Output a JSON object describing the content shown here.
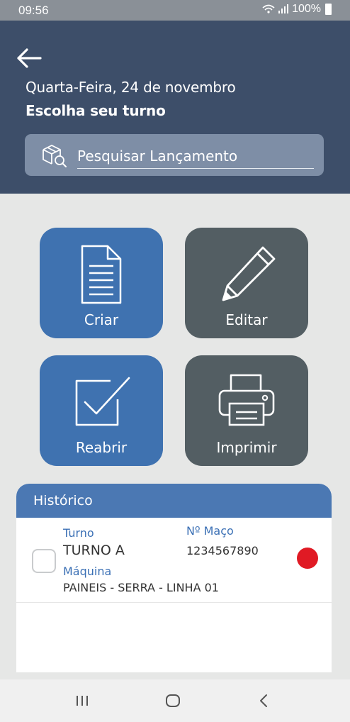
{
  "status_bar": {
    "time": "09:56",
    "battery": "100%"
  },
  "header": {
    "date": "Quarta-Feira, 24 de novembro",
    "subtitle": "Escolha seu turno"
  },
  "search": {
    "placeholder": "Pesquisar Lançamento"
  },
  "actions": [
    {
      "label": "Criar",
      "icon": "document-icon",
      "color": "#3f72b0"
    },
    {
      "label": "Editar",
      "icon": "pencil-icon",
      "color": "#535e63"
    },
    {
      "label": "Reabrir",
      "icon": "checkbox-checked-icon",
      "color": "#3f72b0"
    },
    {
      "label": "Imprimir",
      "icon": "printer-icon",
      "color": "#535e63"
    }
  ],
  "history": {
    "title": "Histórico",
    "items": [
      {
        "turno_label": "Turno",
        "turno": "TURNO A",
        "maco_label": "Nº Maço",
        "maco": "1234567890",
        "maquina_label": "Máquina",
        "maquina": "PAINEIS - SERRA - LINHA 01",
        "status_color": "#e01a24"
      }
    ]
  },
  "nav": {
    "items": [
      "recent-apps-icon",
      "home-icon",
      "back-icon"
    ]
  }
}
